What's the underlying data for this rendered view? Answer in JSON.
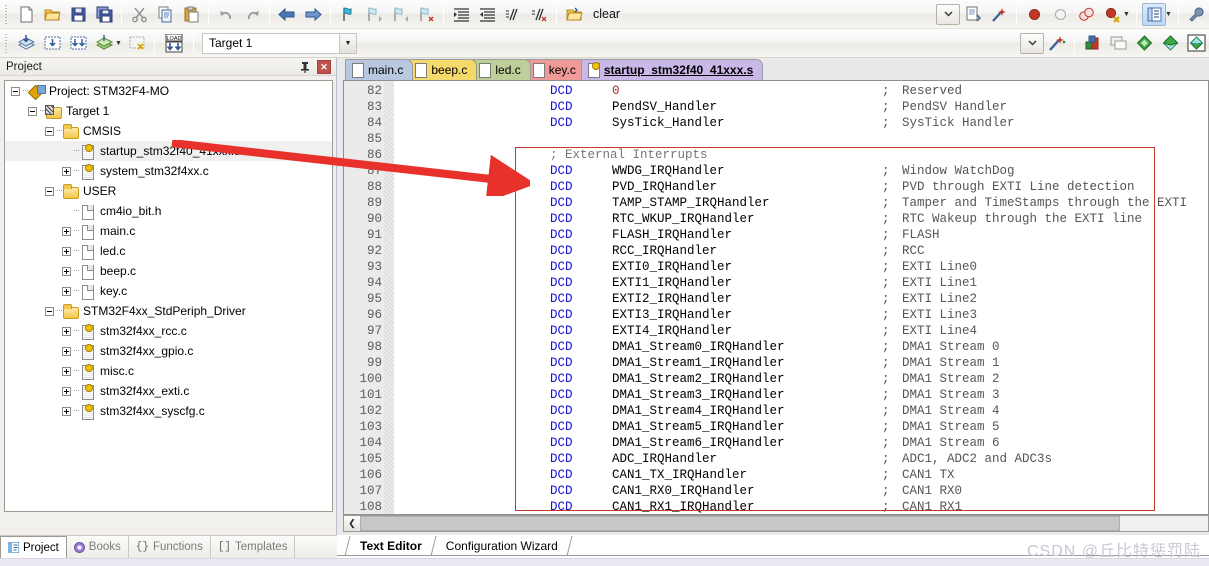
{
  "toolbar_row1": {
    "buttons": [
      {
        "name": "new-file",
        "icon": "new-file-icon"
      },
      {
        "name": "open-file",
        "icon": "open-folder-icon"
      },
      {
        "name": "save",
        "icon": "save-icon"
      },
      {
        "name": "save-all",
        "icon": "save-all-icon"
      },
      {
        "name": "cut",
        "icon": "scissors-icon"
      },
      {
        "name": "copy",
        "icon": "copy-icon"
      },
      {
        "name": "paste",
        "icon": "paste-icon"
      },
      {
        "name": "undo",
        "icon": "undo-arrow-icon"
      },
      {
        "name": "redo",
        "icon": "redo-arrow-icon"
      },
      {
        "name": "navigate-back",
        "icon": "left-arrow-icon"
      },
      {
        "name": "navigate-forward",
        "icon": "right-arrow-icon"
      },
      {
        "name": "bookmark-toggle",
        "icon": "bookmark-flag-icon"
      },
      {
        "name": "bookmark-prev",
        "icon": "bookmark-prev-icon"
      },
      {
        "name": "bookmark-next",
        "icon": "bookmark-next-icon"
      },
      {
        "name": "bookmark-clear",
        "icon": "bookmark-clear-icon"
      },
      {
        "name": "indent",
        "icon": "indent-icon"
      },
      {
        "name": "outdent",
        "icon": "outdent-icon"
      },
      {
        "name": "comment-block",
        "icon": "comment-icon"
      },
      {
        "name": "uncomment-block",
        "icon": "uncomment-icon"
      },
      {
        "name": "open-workspace",
        "icon": "workspace-icon"
      }
    ],
    "clear_label": "clear",
    "right_buttons": [
      {
        "name": "insert-file",
        "icon": "file-insert-icon"
      },
      {
        "name": "configure-magic",
        "icon": "magic-wand-icon"
      },
      {
        "name": "breakpoint-toggle",
        "icon": "red-breakpoint-icon"
      },
      {
        "name": "breakpoint-disable",
        "icon": "hollow-breakpoint-icon"
      },
      {
        "name": "breakpoint-disable-all",
        "icon": "double-breakpoint-icon"
      },
      {
        "name": "breakpoint-kill-all",
        "icon": "breakpoint-delete-icon"
      },
      {
        "name": "project-window-toggle",
        "icon": "project-window-icon"
      },
      {
        "name": "configure-target",
        "icon": "wrench-icon"
      }
    ]
  },
  "toolbar_row2": {
    "buttons": [
      {
        "name": "translate-file",
        "icon": "translate-icon"
      },
      {
        "name": "build-target",
        "icon": "build-icon"
      },
      {
        "name": "rebuild-all",
        "icon": "rebuild-icon"
      },
      {
        "name": "batch-build",
        "icon": "batch-build-icon"
      },
      {
        "name": "stop-build",
        "icon": "stop-build-icon"
      },
      {
        "name": "download",
        "icon": "load-download-icon"
      }
    ],
    "target_value": "Target 1",
    "right_buttons": [
      {
        "name": "target-options",
        "icon": "target-options-icon"
      },
      {
        "name": "manage-runtime",
        "icon": "runtime-env-icon"
      },
      {
        "name": "multi-project",
        "icon": "multi-project-icon"
      },
      {
        "name": "new-component",
        "icon": "green-diamond-icon"
      },
      {
        "name": "component-2",
        "icon": "teal-diamond-icon"
      },
      {
        "name": "component-3",
        "icon": "multicolor-diamond-icon"
      }
    ]
  },
  "project_panel": {
    "title": "Project",
    "pin_icon": "pin-icon",
    "close_icon": "close-icon",
    "tree": [
      {
        "indent": 0,
        "state": "minus",
        "icon": "proj",
        "label": "Project: STM32F4-MO",
        "selected": false
      },
      {
        "indent": 1,
        "state": "minus",
        "icon": "target",
        "label": "Target 1",
        "selected": false
      },
      {
        "indent": 2,
        "state": "minus",
        "icon": "folder",
        "label": "CMSIS",
        "selected": false
      },
      {
        "indent": 3,
        "state": "none",
        "icon": "srcfile",
        "label": "startup_stm32f40_41xxx.s",
        "selected": true
      },
      {
        "indent": 3,
        "state": "plus",
        "icon": "srcfile",
        "label": "system_stm32f4xx.c",
        "selected": false
      },
      {
        "indent": 2,
        "state": "minus",
        "icon": "folder",
        "label": "USER",
        "selected": false
      },
      {
        "indent": 3,
        "state": "none",
        "icon": "file",
        "label": "cm4io_bit.h",
        "selected": false
      },
      {
        "indent": 3,
        "state": "plus",
        "icon": "file",
        "label": "main.c",
        "selected": false
      },
      {
        "indent": 3,
        "state": "plus",
        "icon": "file",
        "label": "led.c",
        "selected": false
      },
      {
        "indent": 3,
        "state": "plus",
        "icon": "file",
        "label": "beep.c",
        "selected": false
      },
      {
        "indent": 3,
        "state": "plus",
        "icon": "file",
        "label": "key.c",
        "selected": false
      },
      {
        "indent": 2,
        "state": "minus",
        "icon": "folder",
        "label": "STM32F4xx_StdPeriph_Driver",
        "selected": false
      },
      {
        "indent": 3,
        "state": "plus",
        "icon": "srcfile",
        "label": "stm32f4xx_rcc.c",
        "selected": false
      },
      {
        "indent": 3,
        "state": "plus",
        "icon": "srcfile",
        "label": "stm32f4xx_gpio.c",
        "selected": false
      },
      {
        "indent": 3,
        "state": "plus",
        "icon": "srcfile",
        "label": "misc.c",
        "selected": false
      },
      {
        "indent": 3,
        "state": "plus",
        "icon": "srcfile",
        "label": "stm32f4xx_exti.c",
        "selected": false
      },
      {
        "indent": 3,
        "state": "plus",
        "icon": "srcfile",
        "label": "stm32f4xx_syscfg.c",
        "selected": false
      }
    ],
    "tabs": [
      {
        "label": "Project",
        "icon": "project-tab-icon",
        "active": true
      },
      {
        "label": "Books",
        "icon": "books-tab-icon",
        "active": false
      },
      {
        "label": "Functions",
        "icon": "functions-tab-icon",
        "active": false
      },
      {
        "label": "Templates",
        "icon": "templates-tab-icon",
        "active": false
      }
    ]
  },
  "editor": {
    "tabs": [
      {
        "label": "main.c",
        "color": "#b9c8e0",
        "active": false,
        "icon": "file-icon"
      },
      {
        "label": "beep.c",
        "color": "#f5d96a",
        "active": false,
        "icon": "file-icon"
      },
      {
        "label": "led.c",
        "color": "#bfcf9a",
        "active": false,
        "icon": "file-icon"
      },
      {
        "label": "key.c",
        "color": "#f09a9a",
        "active": false,
        "icon": "file-icon"
      },
      {
        "label": "startup_stm32f40_41xxx.s",
        "color": "#c9b8e8",
        "active": true,
        "icon": "asm-file-icon"
      }
    ],
    "lines": [
      {
        "n": "82",
        "op": "DCD",
        "arg": "0",
        "arg_kind": "num",
        "comment": "Reserved"
      },
      {
        "n": "83",
        "op": "DCD",
        "arg": "PendSV_Handler",
        "arg_kind": "text",
        "comment": "PendSV Handler"
      },
      {
        "n": "84",
        "op": "DCD",
        "arg": "SysTick_Handler",
        "arg_kind": "text",
        "comment": "SysTick Handler"
      },
      {
        "n": "85",
        "op": "",
        "arg": "",
        "arg_kind": "text",
        "comment": ""
      },
      {
        "n": "86",
        "op": "",
        "arg": "",
        "arg_kind": "full",
        "full": "; External Interrupts",
        "comment": ""
      },
      {
        "n": "87",
        "op": "DCD",
        "arg": "WWDG_IRQHandler",
        "arg_kind": "text",
        "comment": "Window WatchDog"
      },
      {
        "n": "88",
        "op": "DCD",
        "arg": "PVD_IRQHandler",
        "arg_kind": "text",
        "comment": "PVD through EXTI Line detection"
      },
      {
        "n": "89",
        "op": "DCD",
        "arg": "TAMP_STAMP_IRQHandler",
        "arg_kind": "text",
        "comment": "Tamper and TimeStamps through the EXTI"
      },
      {
        "n": "90",
        "op": "DCD",
        "arg": "RTC_WKUP_IRQHandler",
        "arg_kind": "text",
        "comment": "RTC Wakeup through the EXTI line"
      },
      {
        "n": "91",
        "op": "DCD",
        "arg": "FLASH_IRQHandler",
        "arg_kind": "text",
        "comment": "FLASH"
      },
      {
        "n": "92",
        "op": "DCD",
        "arg": "RCC_IRQHandler",
        "arg_kind": "text",
        "comment": "RCC"
      },
      {
        "n": "93",
        "op": "DCD",
        "arg": "EXTI0_IRQHandler",
        "arg_kind": "text",
        "comment": "EXTI Line0"
      },
      {
        "n": "94",
        "op": "DCD",
        "arg": "EXTI1_IRQHandler",
        "arg_kind": "text",
        "comment": "EXTI Line1"
      },
      {
        "n": "95",
        "op": "DCD",
        "arg": "EXTI2_IRQHandler",
        "arg_kind": "text",
        "comment": "EXTI Line2"
      },
      {
        "n": "96",
        "op": "DCD",
        "arg": "EXTI3_IRQHandler",
        "arg_kind": "text",
        "comment": "EXTI Line3"
      },
      {
        "n": "97",
        "op": "DCD",
        "arg": "EXTI4_IRQHandler",
        "arg_kind": "text",
        "comment": "EXTI Line4"
      },
      {
        "n": "98",
        "op": "DCD",
        "arg": "DMA1_Stream0_IRQHandler",
        "arg_kind": "text",
        "comment": "DMA1 Stream 0"
      },
      {
        "n": "99",
        "op": "DCD",
        "arg": "DMA1_Stream1_IRQHandler",
        "arg_kind": "text",
        "comment": "DMA1 Stream 1"
      },
      {
        "n": "100",
        "op": "DCD",
        "arg": "DMA1_Stream2_IRQHandler",
        "arg_kind": "text",
        "comment": "DMA1 Stream 2"
      },
      {
        "n": "101",
        "op": "DCD",
        "arg": "DMA1_Stream3_IRQHandler",
        "arg_kind": "text",
        "comment": "DMA1 Stream 3"
      },
      {
        "n": "102",
        "op": "DCD",
        "arg": "DMA1_Stream4_IRQHandler",
        "arg_kind": "text",
        "comment": "DMA1 Stream 4"
      },
      {
        "n": "103",
        "op": "DCD",
        "arg": "DMA1_Stream5_IRQHandler",
        "arg_kind": "text",
        "comment": "DMA1 Stream 5"
      },
      {
        "n": "104",
        "op": "DCD",
        "arg": "DMA1_Stream6_IRQHandler",
        "arg_kind": "text",
        "comment": "DMA1 Stream 6"
      },
      {
        "n": "105",
        "op": "DCD",
        "arg": "ADC_IRQHandler",
        "arg_kind": "text",
        "comment": "ADC1, ADC2 and ADC3s"
      },
      {
        "n": "106",
        "op": "DCD",
        "arg": "CAN1_TX_IRQHandler",
        "arg_kind": "text",
        "comment": "CAN1 TX"
      },
      {
        "n": "107",
        "op": "DCD",
        "arg": "CAN1_RX0_IRQHandler",
        "arg_kind": "text",
        "comment": "CAN1 RX0"
      },
      {
        "n": "108",
        "op": "DCD",
        "arg": "CAN1_RX1_IRQHandler",
        "arg_kind": "text",
        "comment": "CAN1 RX1"
      }
    ],
    "scroll_left_icon": "scroll-left-icon"
  },
  "bottom": {
    "tabs": [
      {
        "label": "Text Editor",
        "active": true
      },
      {
        "label": "Configuration Wizard",
        "active": false
      }
    ],
    "watermark": "CSDN @丘比特惩罚陆"
  },
  "annotations": {
    "highlight_color": "#c0392b",
    "arrow_color": "#e8312a"
  }
}
